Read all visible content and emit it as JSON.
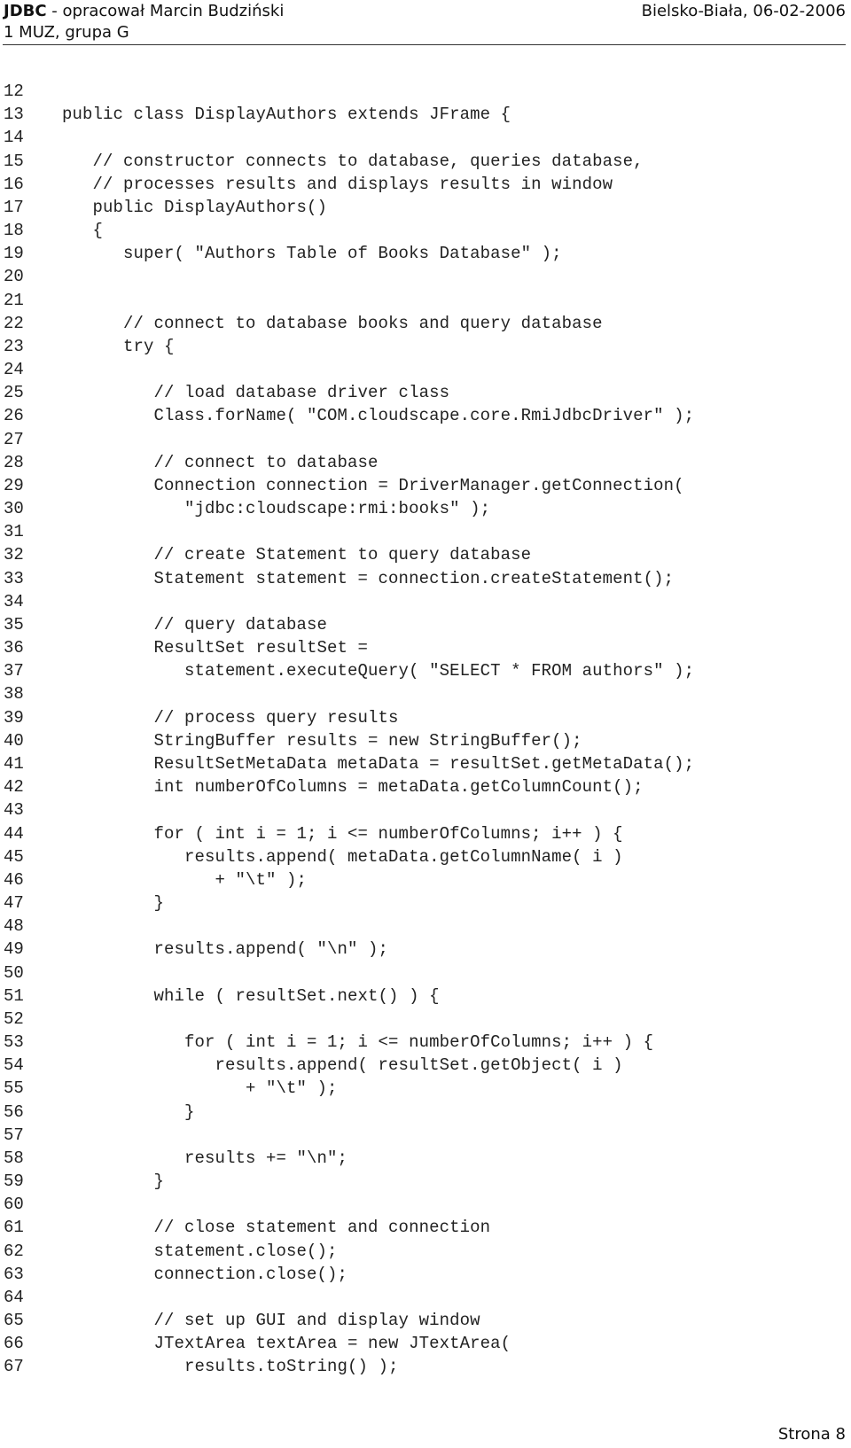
{
  "header": {
    "title_bold": "JDBC",
    "title_rest": " - opracował Marcin Budziński",
    "subtitle": "1 MUZ, grupa G",
    "location_date": "Bielsko-Biała, 06-02-2006"
  },
  "code": {
    "lines": [
      {
        "n": "12",
        "t": ""
      },
      {
        "n": "13",
        "t": "public class DisplayAuthors extends JFrame {"
      },
      {
        "n": "14",
        "t": ""
      },
      {
        "n": "15",
        "t": "   // constructor connects to database, queries database,"
      },
      {
        "n": "16",
        "t": "   // processes results and displays results in window"
      },
      {
        "n": "17",
        "t": "   public DisplayAuthors()"
      },
      {
        "n": "18",
        "t": "   {"
      },
      {
        "n": "19",
        "t": "      super( \"Authors Table of Books Database\" );"
      },
      {
        "n": "20",
        "t": ""
      },
      {
        "n": "21",
        "t": ""
      },
      {
        "n": "22",
        "t": "      // connect to database books and query database"
      },
      {
        "n": "23",
        "t": "      try {"
      },
      {
        "n": "24",
        "t": ""
      },
      {
        "n": "25",
        "t": "         // load database driver class"
      },
      {
        "n": "26",
        "t": "         Class.forName( \"COM.cloudscape.core.RmiJdbcDriver\" );"
      },
      {
        "n": "27",
        "t": ""
      },
      {
        "n": "28",
        "t": "         // connect to database"
      },
      {
        "n": "29",
        "t": "         Connection connection = DriverManager.getConnection("
      },
      {
        "n": "30",
        "t": "            \"jdbc:cloudscape:rmi:books\" );"
      },
      {
        "n": "31",
        "t": ""
      },
      {
        "n": "32",
        "t": "         // create Statement to query database"
      },
      {
        "n": "33",
        "t": "         Statement statement = connection.createStatement();"
      },
      {
        "n": "34",
        "t": ""
      },
      {
        "n": "35",
        "t": "         // query database"
      },
      {
        "n": "36",
        "t": "         ResultSet resultSet ="
      },
      {
        "n": "37",
        "t": "            statement.executeQuery( \"SELECT * FROM authors\" );"
      },
      {
        "n": "38",
        "t": ""
      },
      {
        "n": "39",
        "t": "         // process query results"
      },
      {
        "n": "40",
        "t": "         StringBuffer results = new StringBuffer();"
      },
      {
        "n": "41",
        "t": "         ResultSetMetaData metaData = resultSet.getMetaData();"
      },
      {
        "n": "42",
        "t": "         int numberOfColumns = metaData.getColumnCount();"
      },
      {
        "n": "43",
        "t": ""
      },
      {
        "n": "44",
        "t": "         for ( int i = 1; i <= numberOfColumns; i++ ) {"
      },
      {
        "n": "45",
        "t": "            results.append( metaData.getColumnName( i )"
      },
      {
        "n": "46",
        "t": "               + \"\\t\" );"
      },
      {
        "n": "47",
        "t": "         }"
      },
      {
        "n": "48",
        "t": ""
      },
      {
        "n": "49",
        "t": "         results.append( \"\\n\" );"
      },
      {
        "n": "50",
        "t": ""
      },
      {
        "n": "51",
        "t": "         while ( resultSet.next() ) {"
      },
      {
        "n": "52",
        "t": ""
      },
      {
        "n": "53",
        "t": "            for ( int i = 1; i <= numberOfColumns; i++ ) {"
      },
      {
        "n": "54",
        "t": "               results.append( resultSet.getObject( i )"
      },
      {
        "n": "55",
        "t": "                  + \"\\t\" );"
      },
      {
        "n": "56",
        "t": "            }"
      },
      {
        "n": "57",
        "t": ""
      },
      {
        "n": "58",
        "t": "            results += \"\\n\";"
      },
      {
        "n": "59",
        "t": "         }"
      },
      {
        "n": "60",
        "t": ""
      },
      {
        "n": "61",
        "t": "         // close statement and connection"
      },
      {
        "n": "62",
        "t": "         statement.close();"
      },
      {
        "n": "63",
        "t": "         connection.close();"
      },
      {
        "n": "64",
        "t": ""
      },
      {
        "n": "65",
        "t": "         // set up GUI and display window"
      },
      {
        "n": "66",
        "t": "         JTextArea textArea = new JTextArea("
      },
      {
        "n": "67",
        "t": "            results.toString() );"
      }
    ]
  },
  "footer": {
    "page_label": "Strona 8"
  }
}
